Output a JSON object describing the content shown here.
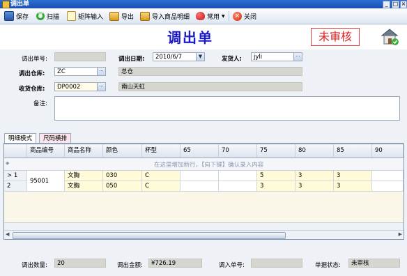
{
  "window": {
    "title": "调出单"
  },
  "toolbar": {
    "save": "保存",
    "scan": "扫描",
    "matrix": "矩阵输入",
    "export": "导出",
    "import": "导入商品明细",
    "common": "常用",
    "close": "关闭"
  },
  "header": {
    "title": "调出单",
    "status_stamp": "未审核"
  },
  "form": {
    "order_no_label": "调出单号:",
    "order_no": "",
    "date_label": "调出日期:",
    "date": "2010/6/7",
    "sender_label": "发货人:",
    "sender": "jyli",
    "out_wh_label": "调出仓库:",
    "out_wh_code": "ZC",
    "out_wh_name": "总仓",
    "in_wh_label": "收货仓库:",
    "in_wh_code": "DP0002",
    "in_wh_name": "南山天虹",
    "remark_label": "备注:",
    "remark": ""
  },
  "tabs": [
    "明细模式",
    "尺码横排"
  ],
  "grid": {
    "columns": [
      "商品编号",
      "商品名称",
      "颜色",
      "杯型",
      "65",
      "70",
      "75",
      "80",
      "85",
      "90"
    ],
    "add_hint": "在这里增加新行，【向下键】确认录入内容",
    "product_code": "95001",
    "rows": [
      {
        "marker": ">",
        "no": "1",
        "name": "文胸",
        "color": "030",
        "cup": "C",
        "s65": "",
        "s70": "",
        "s75": "5",
        "s80": "3",
        "s85": "3",
        "s90": ""
      },
      {
        "marker": "",
        "no": "2",
        "name": "文胸",
        "color": "050",
        "cup": "C",
        "s65": "",
        "s70": "",
        "s75": "3",
        "s80": "3",
        "s85": "3",
        "s90": ""
      }
    ]
  },
  "footer": {
    "qty_label": "调出数量:",
    "qty": "20",
    "amount_label": "调出金额:",
    "amount": "¥726.19",
    "in_no_label": "调入单号:",
    "in_no": "",
    "state_label": "单据状态:",
    "state": "未审核"
  },
  "colors": {
    "title_blue": "#1a1acc",
    "stamp_red": "#e02020",
    "readonly_gray": "#d6d6d0"
  }
}
